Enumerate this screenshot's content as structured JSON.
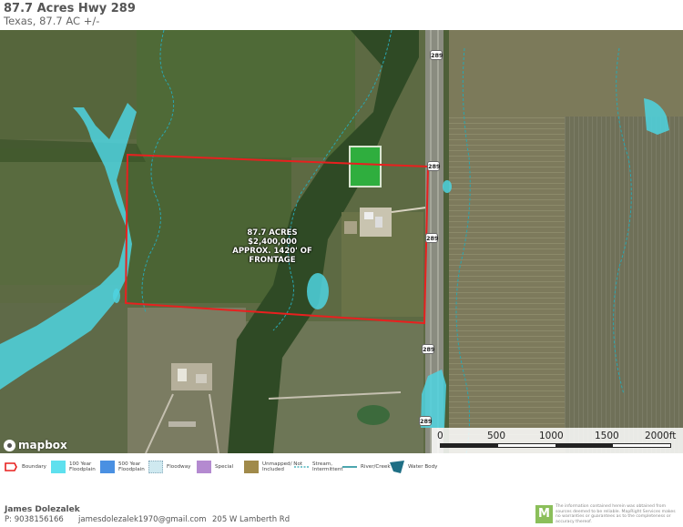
{
  "header": {
    "title": "87.7 Acres Hwy 289",
    "subtitle": "Texas, 87.7 AC +/-"
  },
  "map": {
    "parcel_label": {
      "line1": "87.7 ACRES",
      "line2": "$2,400,000",
      "line3": "APPROX. 1420' OF FRONTAGE"
    },
    "route_shields": [
      "289",
      "289",
      "289",
      "289",
      "289"
    ],
    "attribution": "mapbox",
    "scale": {
      "labels": [
        "0",
        "500",
        "1000",
        "1500",
        "2000ft"
      ]
    },
    "colors": {
      "boundary": "#e8201f",
      "floodplain_100yr": "#4dd4e0",
      "water": "#1fb5c6",
      "pond": "#2fae3e"
    }
  },
  "legend": {
    "items": [
      {
        "label": "Boundary",
        "icon": "boundary-icon"
      },
      {
        "label": "100 Year Floodplain",
        "icon": "floodplain-100-swatch",
        "color": "#5ee0ee"
      },
      {
        "label": "500 Year Floodplain",
        "icon": "floodplain-500-swatch",
        "color": "#4a90e2"
      },
      {
        "label": "Floodway",
        "icon": "floodway-swatch",
        "color": "#cfe9f0"
      },
      {
        "label": "Special",
        "icon": "special-swatch",
        "color": "#b48ad0"
      },
      {
        "label": "Unmapped/ Not Included",
        "icon": "unmapped-swatch",
        "color": "#a08a4a"
      },
      {
        "label": "Stream, Intermittent",
        "icon": "stream-intermittent-icon",
        "color": "#2aa6b0"
      },
      {
        "label": "River/Creek",
        "icon": "river-creek-icon",
        "color": "#1f8f9a"
      },
      {
        "label": "Water Body",
        "icon": "water-body-icon",
        "color": "#1f6f85"
      }
    ]
  },
  "footer": {
    "agent_name": "James Dolezalek",
    "phone": "P: 9038156166",
    "email": "jamesdolezalek1970@gmail.com",
    "address": "205 W Lamberth Rd",
    "logo_letter": "M",
    "disclaimer": "The information contained herein was obtained from sources deemed to be reliable. MapRight Services makes no warranties or guarantees as to the completeness or accuracy thereof."
  }
}
